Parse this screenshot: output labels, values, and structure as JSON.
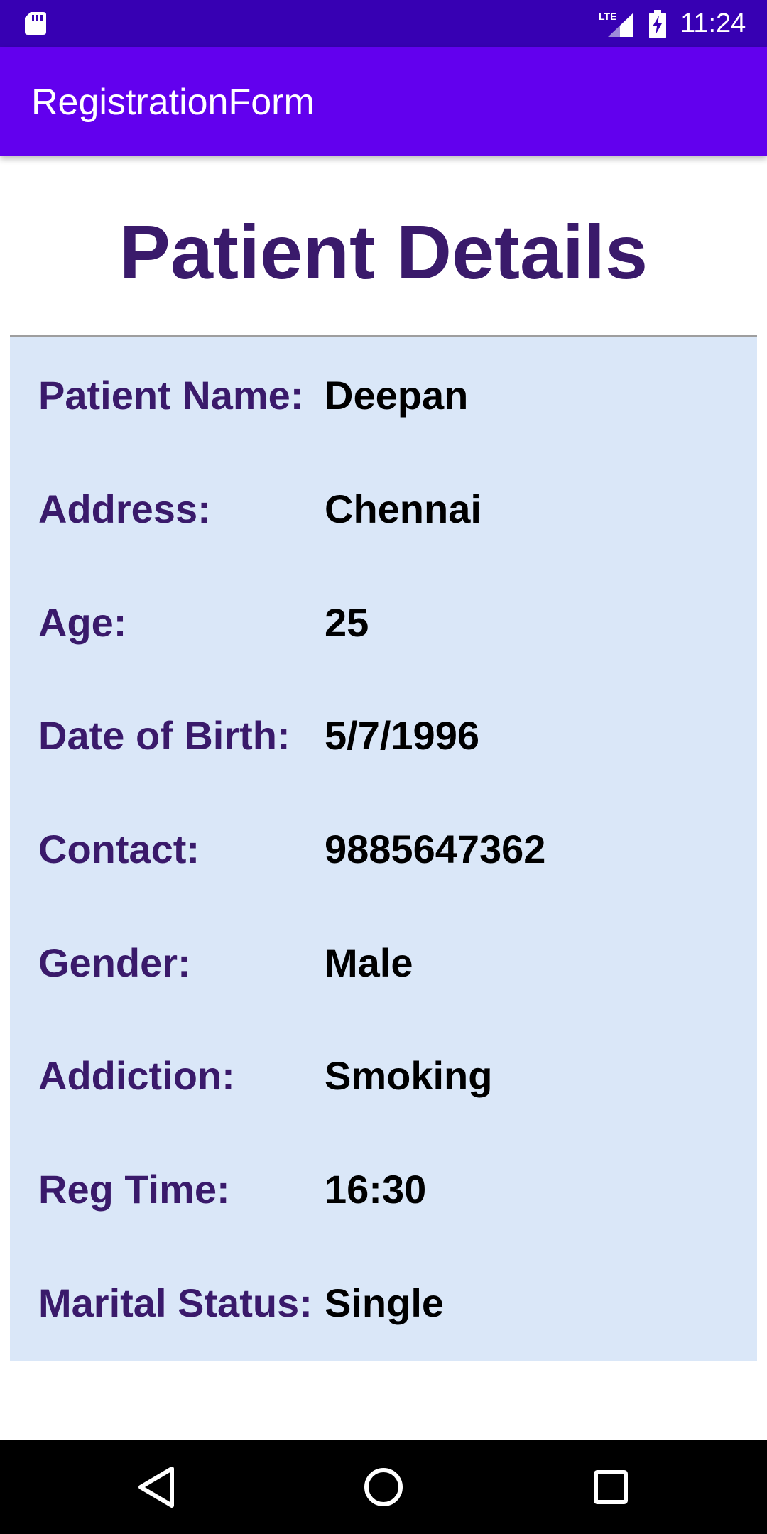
{
  "status_bar": {
    "time": "11:24",
    "network": "LTE",
    "icons": [
      "sd-card-icon",
      "lte-signal-icon",
      "battery-charging-icon"
    ],
    "background": "#3700b3"
  },
  "app_bar": {
    "title": "RegistrationForm",
    "background": "#6200ee"
  },
  "main": {
    "heading": "Patient Details",
    "heading_color": "#3a1a6b",
    "card_background": "#dae7f8",
    "fields": [
      {
        "label": "Patient Name:",
        "value": "Deepan"
      },
      {
        "label": "Address:",
        "value": "Chennai"
      },
      {
        "label": "Age:",
        "value": "25"
      },
      {
        "label": "Date of Birth:",
        "value": "5/7/1996"
      },
      {
        "label": "Contact:",
        "value": "9885647362"
      },
      {
        "label": "Gender:",
        "value": "Male"
      },
      {
        "label": "Addiction:",
        "value": "Smoking"
      },
      {
        "label": "Reg Time:",
        "value": "16:30"
      },
      {
        "label": "Marital Status:",
        "value": "Single"
      }
    ]
  },
  "nav_bar": {
    "buttons": [
      "back-icon",
      "home-icon",
      "recents-icon"
    ]
  }
}
